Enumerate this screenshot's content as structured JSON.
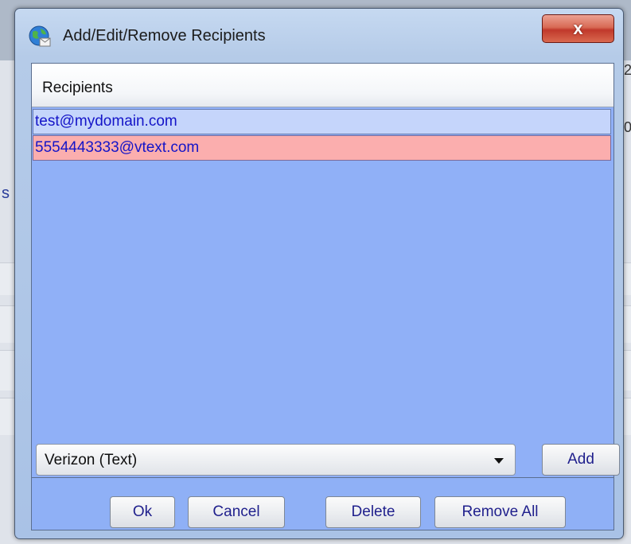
{
  "window": {
    "title": "Add/Edit/Remove Recipients",
    "close_glyph": "x"
  },
  "list": {
    "header": "Recipients",
    "rows": [
      {
        "text": "test@mydomain.com",
        "state": "normal"
      },
      {
        "text": "5554443333@vtext.com",
        "state": "selected"
      }
    ]
  },
  "carrier": {
    "selected": "Verizon (Text)"
  },
  "buttons": {
    "add": "Add",
    "ok": "Ok",
    "cancel": "Cancel",
    "delete": "Delete",
    "remove_all": "Remove All"
  },
  "background": {
    "fragment_letter": "s",
    "right_chars": [
      "2",
      "0"
    ]
  },
  "colors": {
    "list_background": "#90b0f7",
    "row_normal": "#c5d5fb",
    "row_selected": "#fbaeae",
    "text_link": "#1414c8",
    "close_button": "#c0392b"
  },
  "icons": {
    "title": "globe-mail-icon",
    "dropdown": "chevron-down-icon",
    "close": "close-icon"
  }
}
